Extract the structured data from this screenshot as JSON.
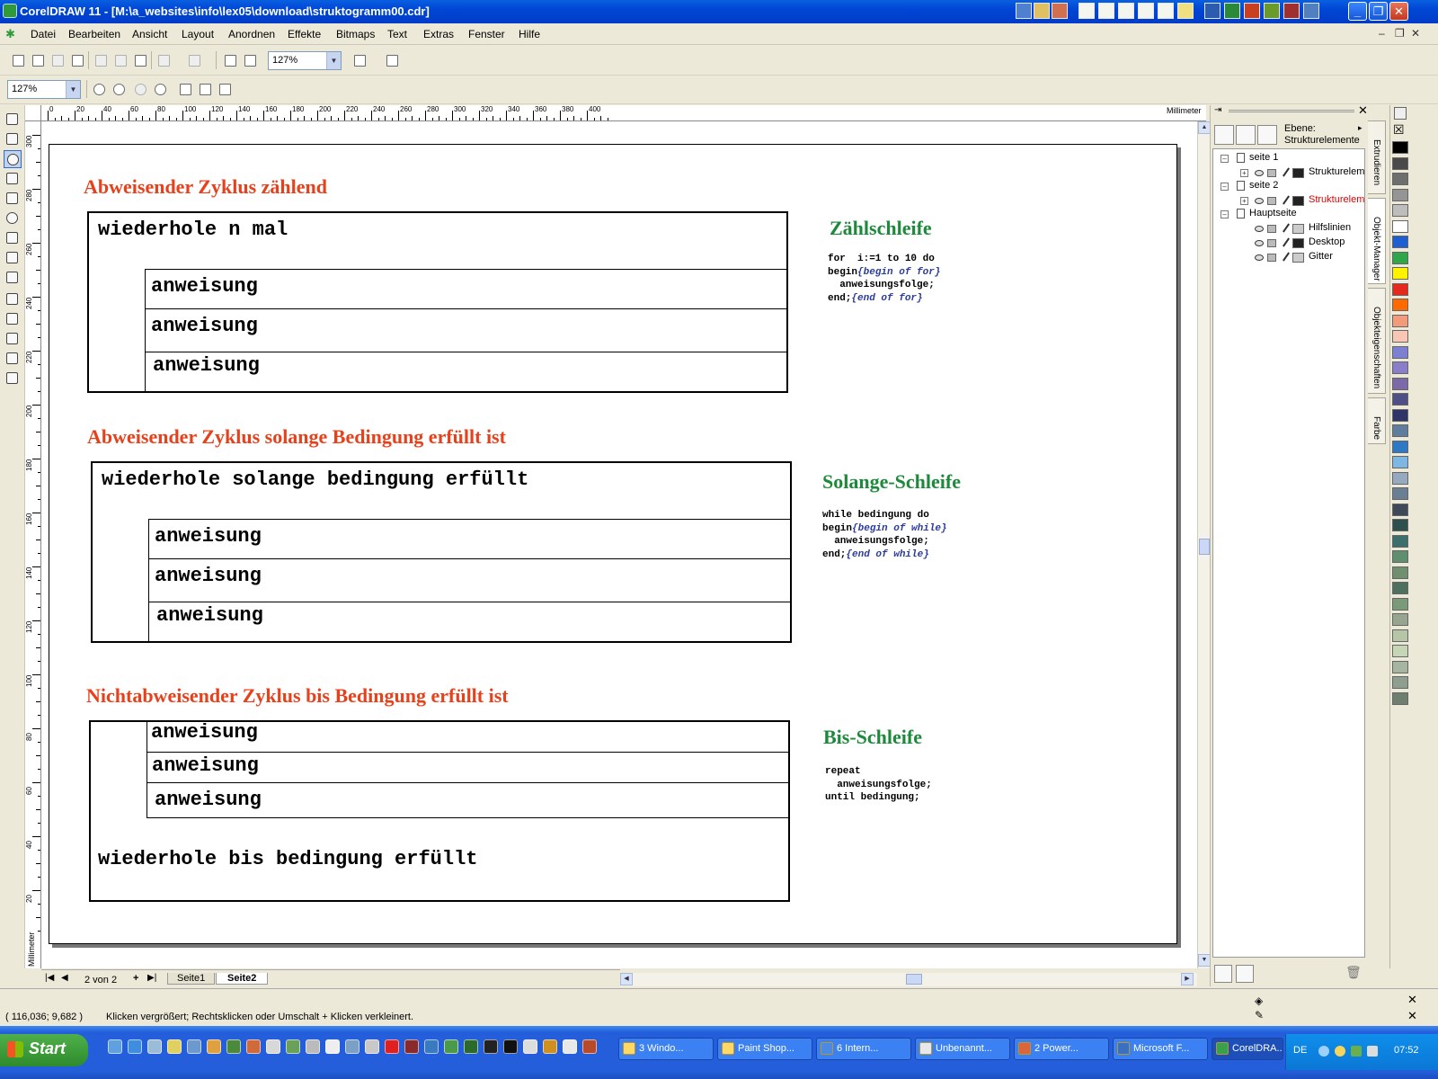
{
  "window": {
    "title": "CorelDRAW 11 - [M:\\a_websites\\info\\lex05\\download\\struktogramm00.cdr]",
    "buttons": [
      "_",
      "❐",
      "✕"
    ]
  },
  "menu": {
    "items": [
      "Datei",
      "Bearbeiten",
      "Ansicht",
      "Layout",
      "Anordnen",
      "Effekte",
      "Bitmaps",
      "Text",
      "Extras",
      "Fenster",
      "Hilfe"
    ],
    "mdi_controls": [
      "–",
      "❐",
      "✕"
    ]
  },
  "toolbar": {
    "zoom_standard": "127%",
    "zoom_property": "127%"
  },
  "rulers": {
    "unit": "Millimeter",
    "top_labels": [
      "0",
      "20",
      "40",
      "60",
      "80",
      "100",
      "120",
      "140",
      "160",
      "180",
      "200",
      "220",
      "240",
      "260",
      "280",
      "300",
      "320",
      "340",
      "360",
      "380",
      "400"
    ],
    "left_labels": [
      "300",
      "280",
      "260",
      "240",
      "220",
      "200",
      "180",
      "160",
      "140",
      "120",
      "100",
      "80",
      "60",
      "40",
      "20"
    ]
  },
  "document": {
    "sections": [
      {
        "heading": "Abweisender Zyklus zählend",
        "loop_label": "wiederhole n mal",
        "statements": [
          "anweisung",
          "anweisung",
          "anweisung"
        ],
        "name": "Zählschleife",
        "code": [
          {
            "text": "for  i:=1 to 10 do",
            "comment": ""
          },
          {
            "text": "begin",
            "comment": "{begin of for}"
          },
          {
            "text": "  anweisungsfolge;",
            "comment": ""
          },
          {
            "text": "end;",
            "comment": "{end of for}"
          }
        ]
      },
      {
        "heading": "Abweisender Zyklus solange Bedingung erfüllt ist",
        "loop_label": "wiederhole solange bedingung erfüllt",
        "statements": [
          "anweisung",
          "anweisung",
          "anweisung"
        ],
        "name": "Solange-Schleife",
        "code": [
          {
            "text": "while bedingung do",
            "comment": ""
          },
          {
            "text": "begin",
            "comment": "{begin of while}"
          },
          {
            "text": "  anweisungsfolge;",
            "comment": ""
          },
          {
            "text": "end;",
            "comment": "{end of while}"
          }
        ]
      },
      {
        "heading": "Nichtabweisender Zyklus bis Bedingung erfüllt ist",
        "loop_label": "wiederhole bis bedingung erfüllt",
        "statements": [
          "anweisung",
          "anweisung",
          "anweisung"
        ],
        "name": "Bis-Schleife",
        "code": [
          {
            "text": "repeat",
            "comment": ""
          },
          {
            "text": "  anweisungsfolge;",
            "comment": ""
          },
          {
            "text": "until bedingung;",
            "comment": ""
          }
        ]
      }
    ]
  },
  "page_nav": {
    "counter": "2 von 2",
    "tabs": [
      "Seite1",
      "Seite2"
    ],
    "active_tab": "Seite2"
  },
  "docker": {
    "layer_label": "Ebene:",
    "layer_value": "Strukturelemente",
    "tree": [
      {
        "label": "seite 1",
        "level": 0
      },
      {
        "label": "Strukturelem",
        "level": 1,
        "swatch": "#222222",
        "highlight": false
      },
      {
        "label": "seite 2",
        "level": 0
      },
      {
        "label": "Strukturelem",
        "level": 1,
        "swatch": "#222222",
        "highlight": true
      },
      {
        "label": "Hauptseite",
        "level": 0
      },
      {
        "label": "Hilfslinien",
        "level": 1,
        "swatch": "#cccccc",
        "highlight": false
      },
      {
        "label": "Desktop",
        "level": 1,
        "swatch": "#222222",
        "highlight": false
      },
      {
        "label": "Gitter",
        "level": 1,
        "swatch": "#cccccc",
        "highlight": false
      }
    ],
    "side_tabs": [
      "Extrudieren",
      "Objekt-Manager",
      "Objekteigenschaften",
      "Farbe"
    ]
  },
  "palette": [
    "#000000",
    "#4a4a4a",
    "#6e6e6e",
    "#959595",
    "#bdbdbd",
    "#ffffff",
    "#1d5fd1",
    "#2fa64a",
    "#fff200",
    "#e32a1c",
    "#ff6a00",
    "#f39a7a",
    "#f7c6b5",
    "#7d7fd1",
    "#8a7dc9",
    "#7c6aa8",
    "#4d4f86",
    "#2f3667",
    "#5f7e9d",
    "#2e79c4",
    "#7fb7e3",
    "#95a9bf",
    "#6a7f94",
    "#3e4a5a",
    "#2f4f4f",
    "#3c6e6e",
    "#5f8f6f",
    "#6f8f6f",
    "#4f6f5f",
    "#7a9a7a",
    "#95a58f",
    "#b5c5a5",
    "#c5d5b5",
    "#a5b59f",
    "#8f9f8f",
    "#6f7f6f"
  ],
  "status": {
    "coords": "( 116,036; 9,682 )",
    "hint": "Klicken vergrößert; Rechtsklicken oder Umschalt + Klicken verkleinert."
  },
  "taskbar": {
    "start": "Start",
    "tasks": [
      "3 Windo...",
      "Paint Shop...",
      "6 Intern...",
      "Unbenannt...",
      "2 Power...",
      "Microsoft F...",
      "CorelDRA..."
    ],
    "active_task": "CorelDRA...",
    "lang": "DE",
    "clock": "07:52"
  }
}
